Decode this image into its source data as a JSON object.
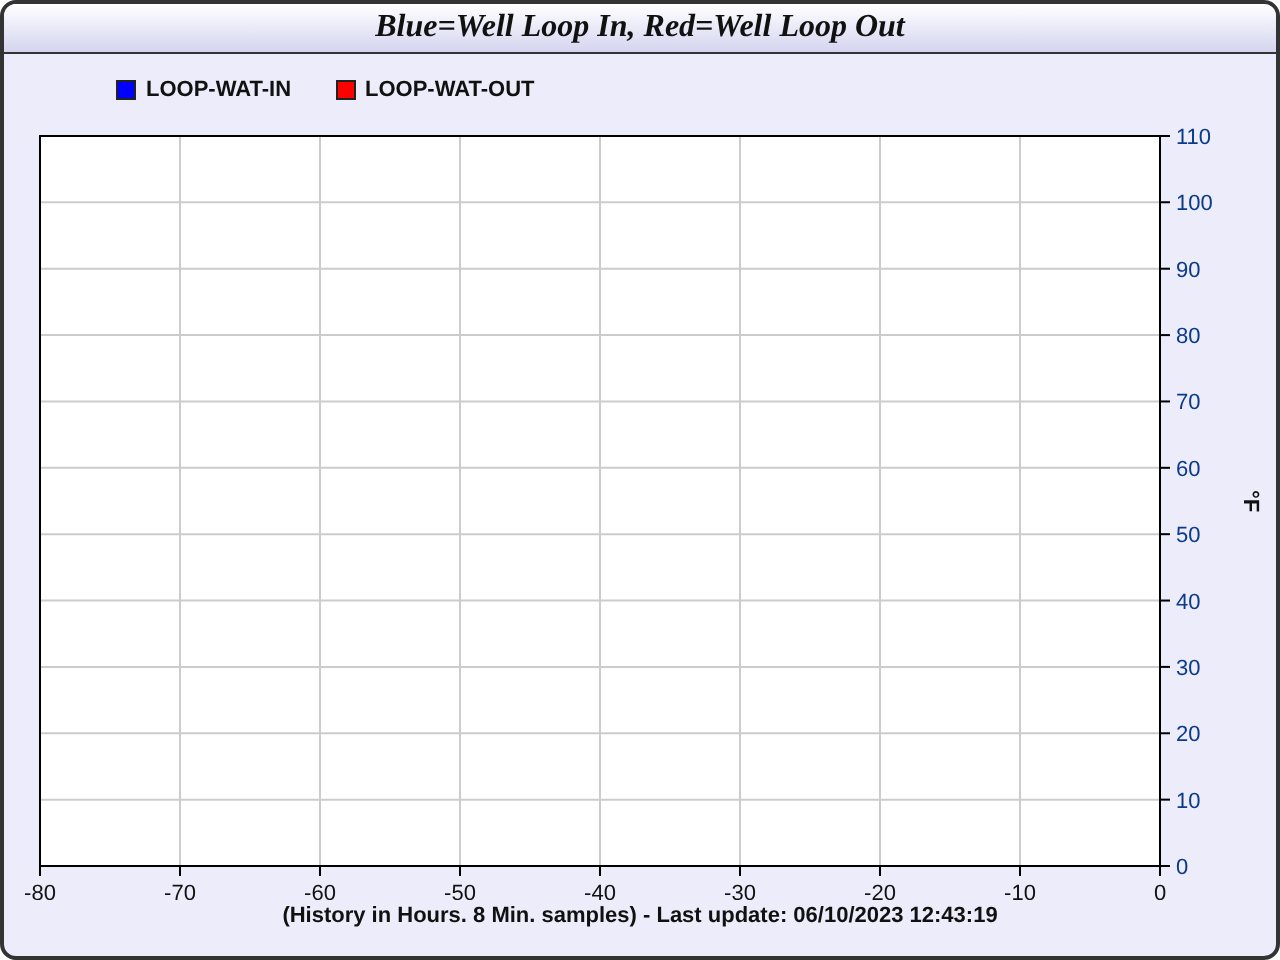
{
  "window": {
    "title": "Blue=Well Loop In, Red=Well Loop Out"
  },
  "chart": {
    "chart_data": {
      "type": "line",
      "ylabel": "°F",
      "xlabel": "(History in Hours. 8 Min. samples) - Last update: 06/10/2023 12:43:19",
      "series": [
        {
          "name": "LOOP-WAT-IN",
          "color": "#0000ff",
          "values": [
            null,
            null,
            null,
            null,
            null,
            null,
            null,
            null,
            null
          ]
        },
        {
          "name": "LOOP-WAT-OUT",
          "color": "#ff0000",
          "values": [
            null,
            null,
            null,
            null,
            null,
            null,
            null,
            null,
            null
          ]
        }
      ],
      "categories": [
        "-80",
        "-70",
        "-60",
        "-50",
        "-40",
        "-30",
        "-20",
        "-10",
        "0"
      ],
      "grid": true,
      "ylim": [
        0,
        110
      ],
      "yticks": [
        0,
        10,
        20,
        30,
        40,
        50,
        60,
        70,
        80,
        90,
        100,
        110
      ]
    }
  }
}
